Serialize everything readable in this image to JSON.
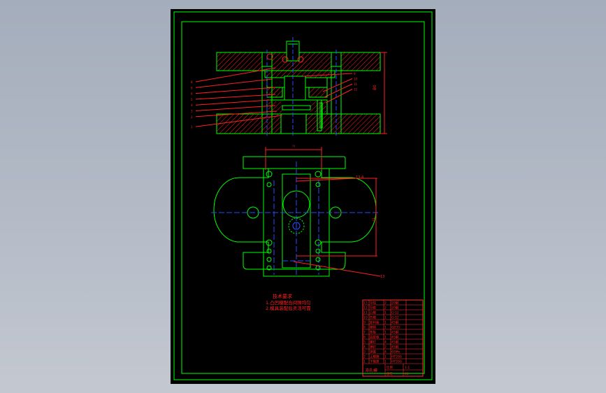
{
  "viewer": {
    "background": "#a9b2bf",
    "sheet_color": "#000000"
  },
  "colors": {
    "frame": "#00ff00",
    "outline": "#00ff00",
    "hatch": "#ff0000",
    "centerline": "#2a4cff",
    "dimension": "#ff2020",
    "leader": "#ff2020",
    "annotation": "#ff2020",
    "table_line": "#ff3030"
  },
  "section_view": {
    "part_labels_left": [
      "8",
      "9",
      "6",
      "5",
      "4",
      "3",
      "2",
      "1"
    ],
    "part_labels_right": [
      "9",
      "10",
      "11",
      "12"
    ],
    "height_dimension": "80"
  },
  "plan_view": {
    "top_dimension": "??",
    "side_dimension": "??",
    "note_label": "13.4",
    "bottom_callout": "13"
  },
  "technical_requirements": {
    "title": "技术要求",
    "lines": [
      "1.凸凹模配合间隙均匀",
      "2.模具装配后灵活可靠"
    ]
  },
  "parts_table": {
    "rows": [
      [
        "13",
        "导柱",
        "2",
        "20钢",
        ""
      ],
      [
        "12",
        "导套",
        "2",
        "20钢",
        ""
      ],
      [
        "11",
        "凸模",
        "1",
        "Cr12",
        ""
      ],
      [
        "10",
        "凹模",
        "1",
        "Cr12",
        ""
      ],
      [
        "9",
        "卸料板",
        "1",
        "45钢",
        ""
      ],
      [
        "8",
        "模柄",
        "1",
        "Q235",
        ""
      ],
      [
        "7",
        "垫板",
        "1",
        "45钢",
        ""
      ],
      [
        "6",
        "固定板",
        "1",
        "45钢",
        ""
      ],
      [
        "5",
        "螺钉",
        "4",
        "45钢",
        ""
      ],
      [
        "4",
        "销钉",
        "2",
        "45钢",
        ""
      ],
      [
        "3",
        "弹簧",
        "4",
        "65Mn",
        ""
      ],
      [
        "2",
        "上模座",
        "1",
        "HT200",
        ""
      ],
      [
        "1",
        "下模座",
        "1",
        "HT200",
        ""
      ]
    ],
    "title_block": [
      "冲孔模",
      "比例",
      "1:1",
      "图号",
      "01"
    ]
  }
}
